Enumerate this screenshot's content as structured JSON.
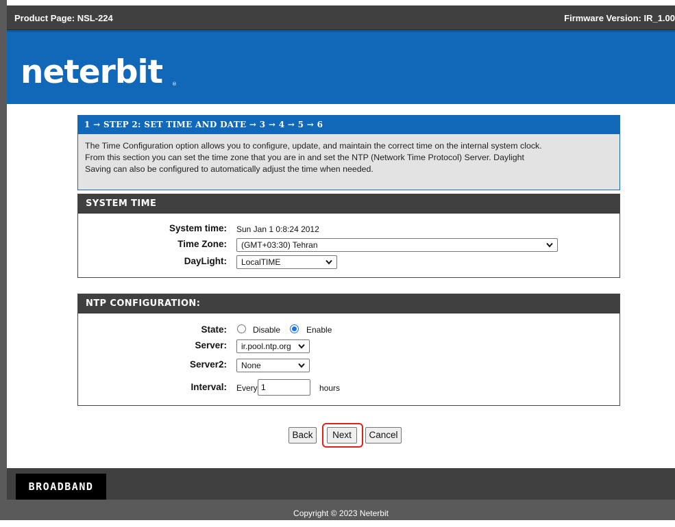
{
  "topbar": {
    "product_page": "Product Page: NSL-224",
    "firmware": "Firmware Version: IR_1.00"
  },
  "brand": {
    "logo_text": "neterbit",
    "logo_color": "#ffffff",
    "banner_color": "#1168b9"
  },
  "wizard": {
    "step_title": "1 → STEP 2: SET TIME AND DATE → 3 → 4 → 5 → 6",
    "description_lines": [
      "The Time Configuration option allows you to configure, update, and maintain the correct time on the internal system clock.",
      "From this section you can set the time zone that you are in and set the NTP (Network Time Protocol) Server. Daylight",
      "Saving can also be configured to automatically adjust the time when needed."
    ]
  },
  "system_time": {
    "header": "SYSTEM TIME",
    "system_time_label": "System time:",
    "system_time_value": "Sun Jan 1 0:8:24 2012",
    "time_zone_label": "Time Zone:",
    "time_zone_value": "(GMT+03:30) Tehran",
    "daylight_label": "DayLight:",
    "daylight_value": "LocalTIME"
  },
  "ntp": {
    "header": "NTP CONFIGURATION:",
    "state_label": "State:",
    "state_disable": "Disable",
    "state_enable": "Enable",
    "state_selected": "Enable",
    "server_label": "Server:",
    "server_value": "ir.pool.ntp.org",
    "server2_label": "Server2:",
    "server2_value": "None",
    "interval_label": "Interval:",
    "interval_prefix": "Every",
    "interval_value": "1",
    "interval_unit": "hours"
  },
  "buttons": {
    "back": "Back",
    "next": "Next",
    "cancel": "Cancel",
    "highlight_color": "#e0201a"
  },
  "footer": {
    "badge": "BROADBAND",
    "copyright": "Copyright © 2023 Neterbit"
  }
}
